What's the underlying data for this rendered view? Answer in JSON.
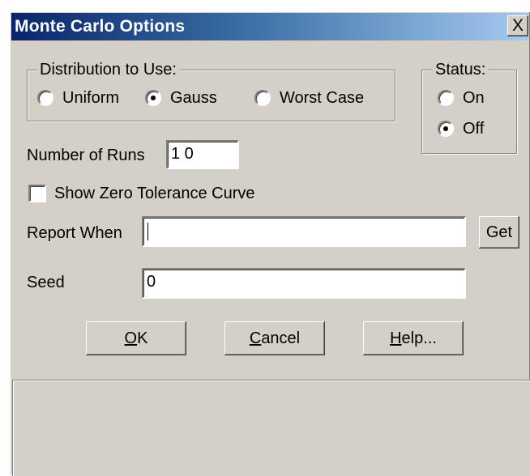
{
  "window": {
    "title": "Monte Carlo Options",
    "close_glyph": "X"
  },
  "distribution": {
    "legend": "Distribution to Use:",
    "options": [
      {
        "label": "Uniform",
        "selected": false
      },
      {
        "label": "Gauss",
        "selected": true
      },
      {
        "label": "Worst Case",
        "selected": false
      }
    ]
  },
  "status": {
    "legend": "Status:",
    "options": [
      {
        "label": "On",
        "selected": false
      },
      {
        "label": "Off",
        "selected": true
      }
    ]
  },
  "runs": {
    "label": "Number of Runs",
    "value": "1 0"
  },
  "zero_tolerance": {
    "label": "Show Zero Tolerance Curve",
    "checked": false
  },
  "report_when": {
    "label": "Report When",
    "value": "",
    "get_button": "Get"
  },
  "seed": {
    "label": "Seed",
    "value": "0"
  },
  "buttons": {
    "ok": {
      "mnemonic": "O",
      "rest": "K"
    },
    "cancel": {
      "mnemonic": "C",
      "rest": "ancel"
    },
    "help": {
      "mnemonic": "H",
      "rest": "elp..."
    }
  },
  "icons": {
    "radio": "radio-button-icon",
    "checkbox": "checkbox-icon",
    "close": "close-icon"
  }
}
